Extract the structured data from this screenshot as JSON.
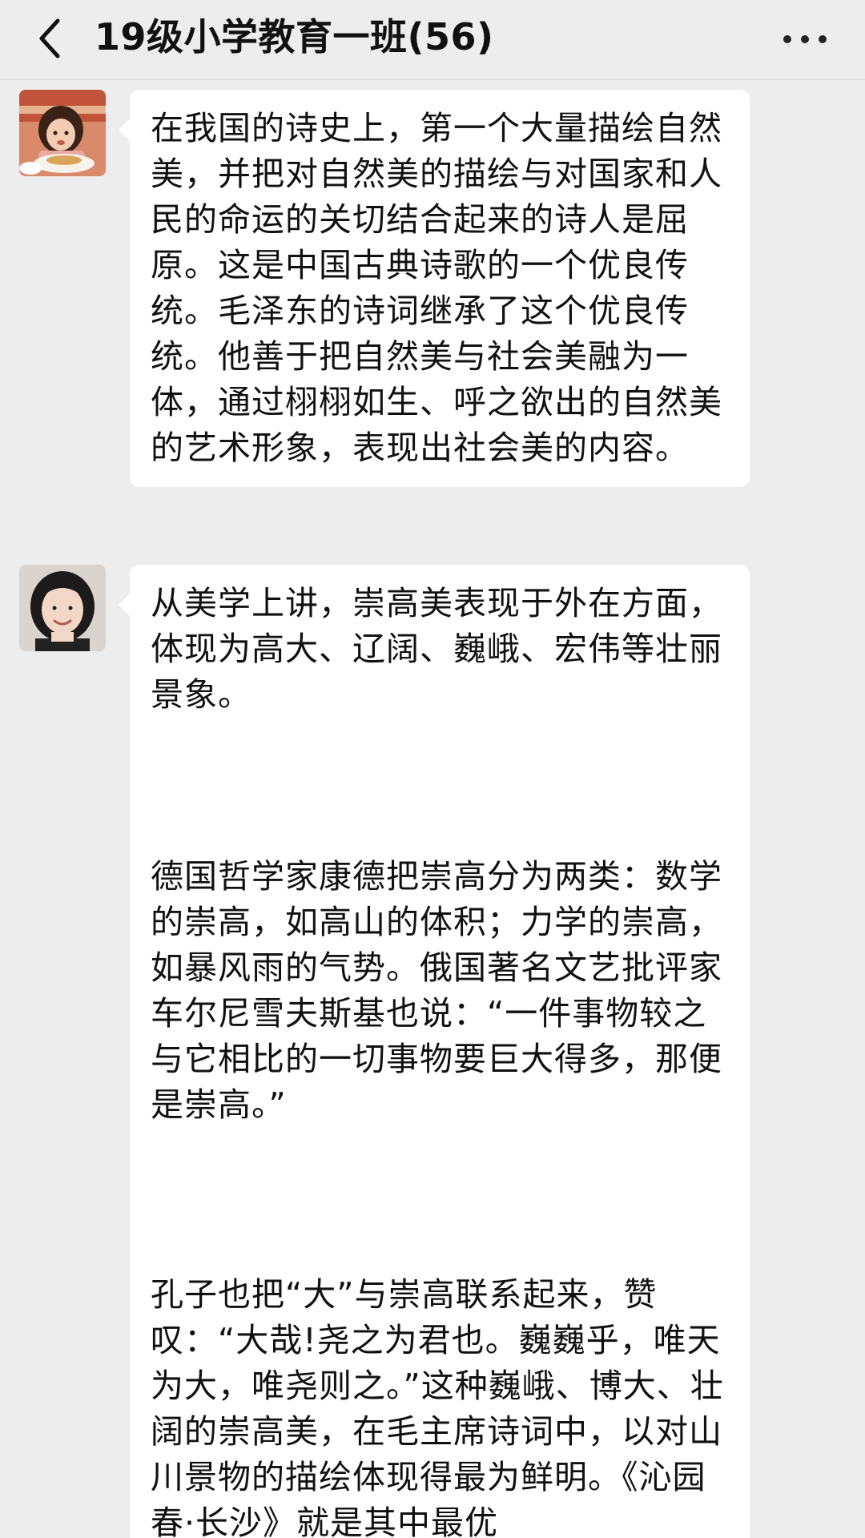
{
  "header": {
    "title": "19级小学教育一班(56)",
    "back_icon": "chevron-left-icon",
    "more_icon": "more-dots-icon"
  },
  "messages": [
    {
      "avatar": "avatar-girl-eating",
      "paragraphs": [
        "在我国的诗史上，第一个大量描绘自然美，并把对自然美的描绘与对国家和人民的命运的关切结合起来的诗人是屈原。这是中国古典诗歌的一个优良传统。毛泽东的诗词继承了这个优良传统。他善于把自然美与社会美融为一体，通过栩栩如生、呼之欲出的自然美的艺术形象，表现出社会美的内容。"
      ]
    },
    {
      "avatar": "avatar-girl-smiling",
      "paragraphs": [
        "从美学上讲，崇高美表现于外在方面，体现为高大、辽阔、巍峨、宏伟等壮丽景象。",
        "德国哲学家康德把崇高分为两类：数学的崇高，如高山的体积；力学的崇高，如暴风雨的气势。俄国著名文艺批评家车尔尼雪夫斯基也说：“一件事物较之与它相比的一切事物要巨大得多，那便是崇高。”",
        "孔子也把“大”与崇高联系起来，赞叹：“大哉!尧之为君也。巍巍乎，唯天为大，唯尧则之。”这种巍峨、博大、壮阔的崇高美，在毛主席诗词中，以对山川景物的描绘体现得最为鲜明。《沁园春·长沙》就是其中最优"
      ]
    }
  ],
  "colors": {
    "background": "#ededed",
    "bubble": "#ffffff",
    "text": "#111111"
  }
}
